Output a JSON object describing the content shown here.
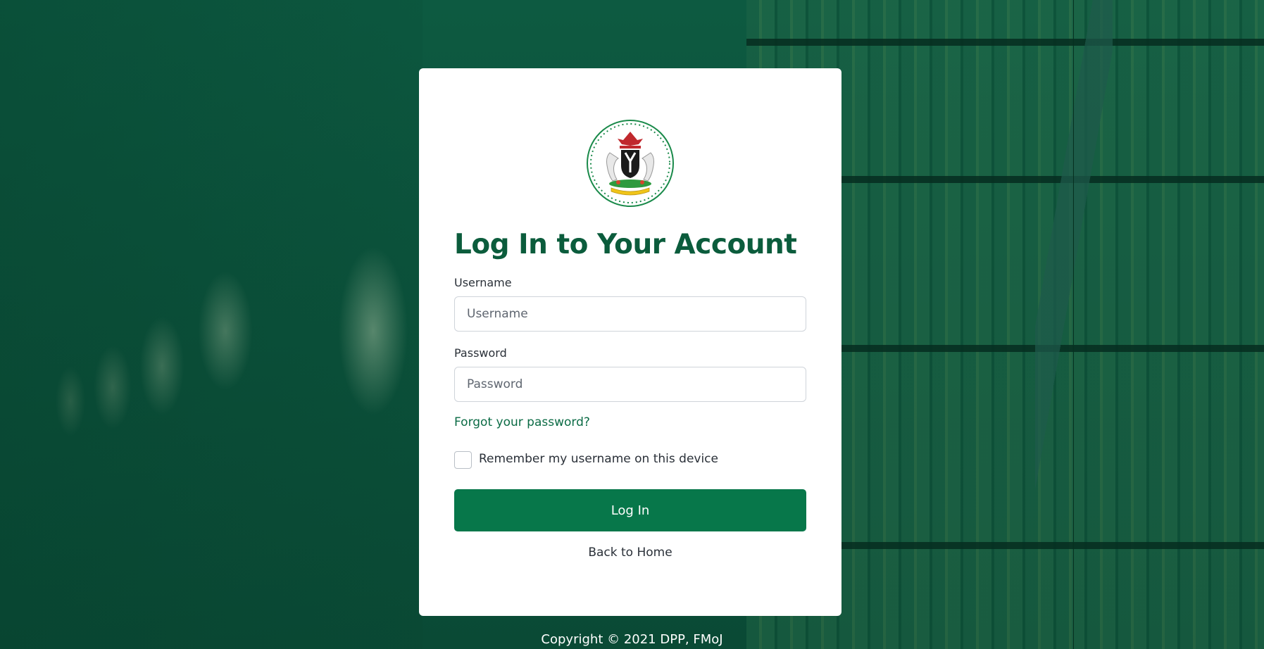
{
  "login": {
    "title": "Log In to Your Account",
    "username_label": "Username",
    "username_placeholder": "Username",
    "username_value": "",
    "password_label": "Password",
    "password_placeholder": "Password",
    "password_value": "",
    "forgot_link": "Forgot your password?",
    "remember_label": "Remember my username on this device",
    "remember_checked": false,
    "submit_label": "Log In",
    "back_link": "Back to Home"
  },
  "footer": {
    "copyright": "Copyright © 2021 DPP, FMoJ"
  },
  "logo": {
    "icon": "nigeria-coat-of-arms-icon"
  },
  "colors": {
    "brand_green": "#07774a",
    "title_green": "#0b5c3c",
    "link_green": "#0b6b45",
    "background_overlay": "#0d5a41"
  }
}
